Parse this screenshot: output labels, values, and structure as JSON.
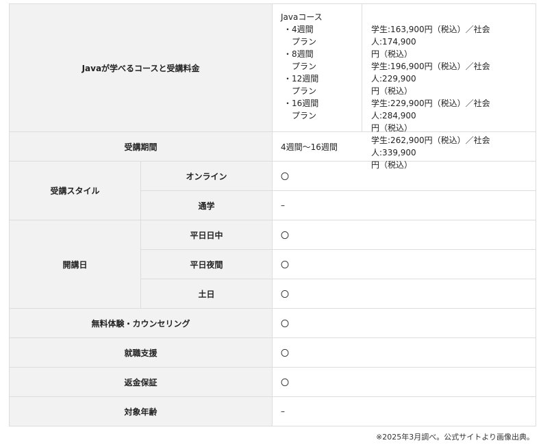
{
  "rows": {
    "course": {
      "label": "Javaが学べるコースと受講料金",
      "course_name": "Javaコース",
      "plans": [
        {
          "name": "・4週間",
          "suffix": "プラン",
          "price": "学生:163,900円（税込）／社会人:174,900",
          "price_cont": "円（税込）"
        },
        {
          "name": "・8週間",
          "suffix": "プラン",
          "price": "学生:196,900円（税込）／社会人:229,900",
          "price_cont": "円（税込）"
        },
        {
          "name": "・12週間",
          "suffix": "プラン",
          "price": "学生:229,900円（税込）／社会人:284,900",
          "price_cont": "円（税込）"
        },
        {
          "name": "・16週間",
          "suffix": "プラン",
          "price": "学生:262,900円（税込）／社会人:339,900",
          "price_cont": "円（税込）"
        }
      ]
    },
    "period": {
      "label": "受講期間",
      "value": "4週間〜16週間"
    },
    "style": {
      "label": "受講スタイル",
      "online": "オンライン",
      "online_value": "〇",
      "commute": "通学",
      "commute_value": "–"
    },
    "days": {
      "label": "開講日",
      "weekday_day": "平日日中",
      "weekday_day_value": "〇",
      "weekday_night": "平日夜間",
      "weekday_night_value": "〇",
      "weekend": "土日",
      "weekend_value": "〇"
    },
    "trial": {
      "label": "無料体験・カウンセリング",
      "value": "〇"
    },
    "career": {
      "label": "就職支援",
      "value": "〇"
    },
    "refund": {
      "label": "返金保証",
      "value": "〇"
    },
    "age": {
      "label": "対象年齢",
      "value": "–"
    }
  },
  "footnote": "※2025年3月調べ。公式サイトより画像出典。"
}
